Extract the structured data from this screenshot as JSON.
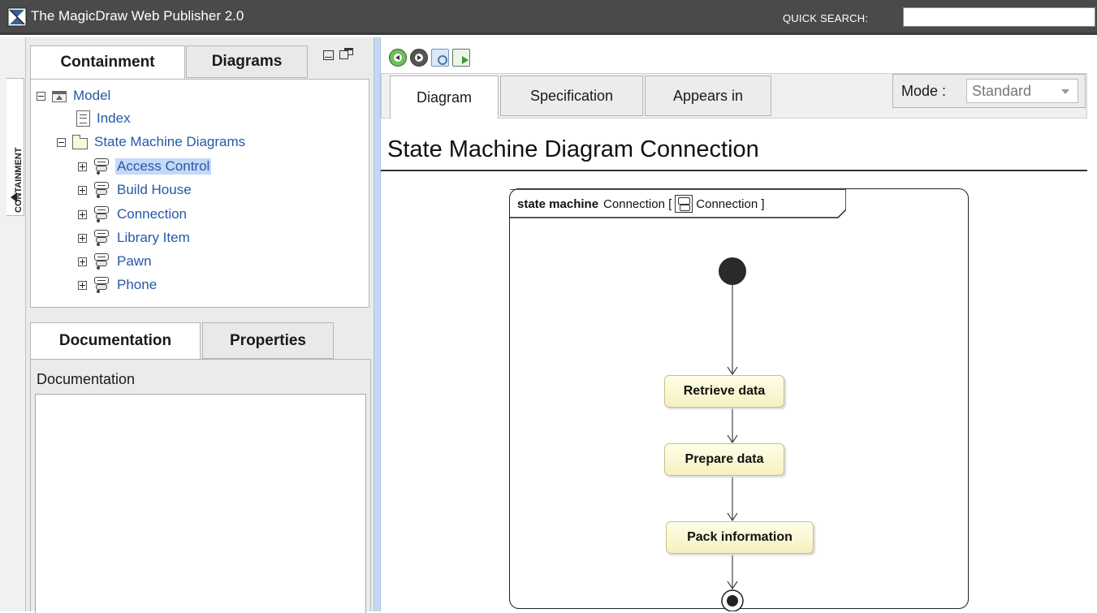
{
  "app": {
    "title": "The MagicDraw Web Publisher 2.0",
    "quick_search_label": "QUICK SEARCH:",
    "quick_search_value": ""
  },
  "side_strip": {
    "label": "CONTAINMENT"
  },
  "left_panel": {
    "tabs": [
      {
        "label": "Containment",
        "active": true
      },
      {
        "label": "Diagrams",
        "active": false
      }
    ],
    "tree": [
      {
        "label": "Model",
        "icon": "model-icon",
        "expander": "minus",
        "level": 0
      },
      {
        "label": "Index",
        "icon": "document-icon",
        "expander": "none",
        "level": 1
      },
      {
        "label": "State Machine Diagrams",
        "icon": "folder-icon",
        "expander": "minus",
        "level": 1
      },
      {
        "label": "Access Control",
        "icon": "state-machine-icon",
        "expander": "plus",
        "level": 2,
        "selected": true
      },
      {
        "label": "Build House",
        "icon": "state-machine-icon",
        "expander": "plus",
        "level": 2
      },
      {
        "label": "Connection",
        "icon": "state-machine-icon",
        "expander": "plus",
        "level": 2
      },
      {
        "label": "Library Item",
        "icon": "state-machine-icon",
        "expander": "plus",
        "level": 2
      },
      {
        "label": "Pawn",
        "icon": "state-machine-icon",
        "expander": "plus",
        "level": 2
      },
      {
        "label": "Phone",
        "icon": "state-machine-icon",
        "expander": "plus",
        "level": 2
      }
    ],
    "bottom_tabs": [
      {
        "label": "Documentation",
        "active": true
      },
      {
        "label": "Properties",
        "active": false
      }
    ],
    "documentation_label": "Documentation",
    "documentation_text": ""
  },
  "right_panel": {
    "toolbar": [
      "back-icon",
      "forward-icon",
      "find-icon",
      "export-icon"
    ],
    "tabs": [
      {
        "label": "Diagram",
        "active": true
      },
      {
        "label": "Specification",
        "active": false
      },
      {
        "label": "Appears in",
        "active": false
      }
    ],
    "mode_label": "Mode :",
    "mode_value": "Standard",
    "diagram_title": "State Machine Diagram Connection",
    "diagram": {
      "keyword": "state machine",
      "name": "Connection [",
      "context": "Connection ]",
      "states": [
        "Retrieve data",
        "Prepare data",
        "Pack information"
      ]
    }
  },
  "colors": {
    "titlebar": "#4a4a4a",
    "link": "#2658a5",
    "selection": "#c4d9f7",
    "splitter": "#c6d8ef",
    "state_fill": "#fffbe0"
  }
}
